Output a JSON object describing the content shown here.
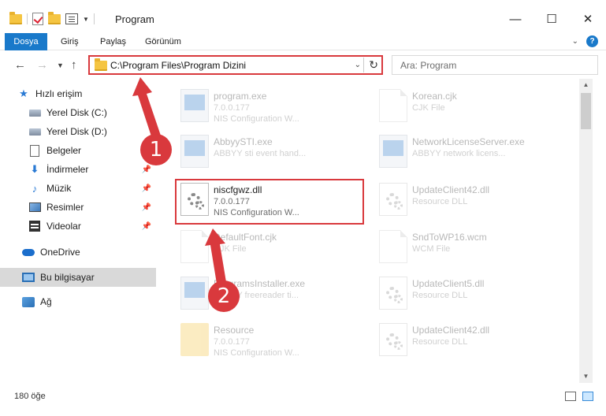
{
  "titlebar": {
    "title": "Program",
    "minimize_glyph": "—",
    "maximize_glyph": "☐",
    "close_glyph": "✕"
  },
  "ribbon": {
    "tabs": [
      "Dosya",
      "Giriş",
      "Paylaş",
      "Görünüm"
    ],
    "help_glyph": "?"
  },
  "navigation": {
    "address": "C:\\Program Files\\Program Dizini",
    "search_placeholder": "Ara: Program"
  },
  "sidebar": {
    "items": [
      {
        "label": "Hızlı erişim",
        "icon": "star-icon"
      },
      {
        "label": "Yerel Disk (C:)",
        "icon": "drive-icon"
      },
      {
        "label": "Yerel Disk (D:)",
        "icon": "drive-icon"
      },
      {
        "label": "Belgeler",
        "icon": "documents-icon"
      },
      {
        "label": "İndirmeler",
        "icon": "downloads-icon"
      },
      {
        "label": "Müzik",
        "icon": "music-icon"
      },
      {
        "label": "Resimler",
        "icon": "pictures-icon"
      },
      {
        "label": "Videolar",
        "icon": "videos-icon"
      },
      {
        "label": "OneDrive",
        "icon": "cloud-icon"
      },
      {
        "label": "Bu bilgisayar",
        "icon": "computer-icon"
      },
      {
        "label": "Ağ",
        "icon": "network-icon"
      }
    ]
  },
  "files": [
    {
      "name": "program.exe",
      "line1": "7.0.0.177",
      "line2": "NIS Configuration W..."
    },
    {
      "name": "Korean.cjk",
      "line1": "CJK File",
      "line2": ""
    },
    {
      "name": "AbbyySTI.exe",
      "line1": "ABBYY sti event hand...",
      "line2": ""
    },
    {
      "name": "NetworkLicenseServer.exe",
      "line1": "ABBYY network licens...",
      "line2": ""
    },
    {
      "name": "niscfgwz.dll",
      "line1": "7.0.0.177",
      "line2": "NIS Configuration W..."
    },
    {
      "name": "UpdateClient42.dll",
      "line1": "Resource DLL",
      "line2": ""
    },
    {
      "name": "DefaultFont.cjk",
      "line1": "CJK File",
      "line2": ""
    },
    {
      "name": "SndToWP16.wcm",
      "line1": "WCM File",
      "line2": ""
    },
    {
      "name": "ProgramsInstaller.exe",
      "line1": "ABBYY freereader ti...",
      "line2": ""
    },
    {
      "name": "UpdateClient5.dll",
      "line1": "Resource DLL",
      "line2": ""
    },
    {
      "name": "Resource",
      "line1": "7.0.0.177",
      "line2": "NIS Configuration W..."
    },
    {
      "name": "UpdateClient42.dll",
      "line1": "Resource DLL",
      "line2": ""
    }
  ],
  "status": {
    "count": "180 öğe"
  },
  "callouts": [
    "1",
    "2"
  ],
  "colors": {
    "accent": "#1979ca",
    "highlight": "#d9393d"
  }
}
